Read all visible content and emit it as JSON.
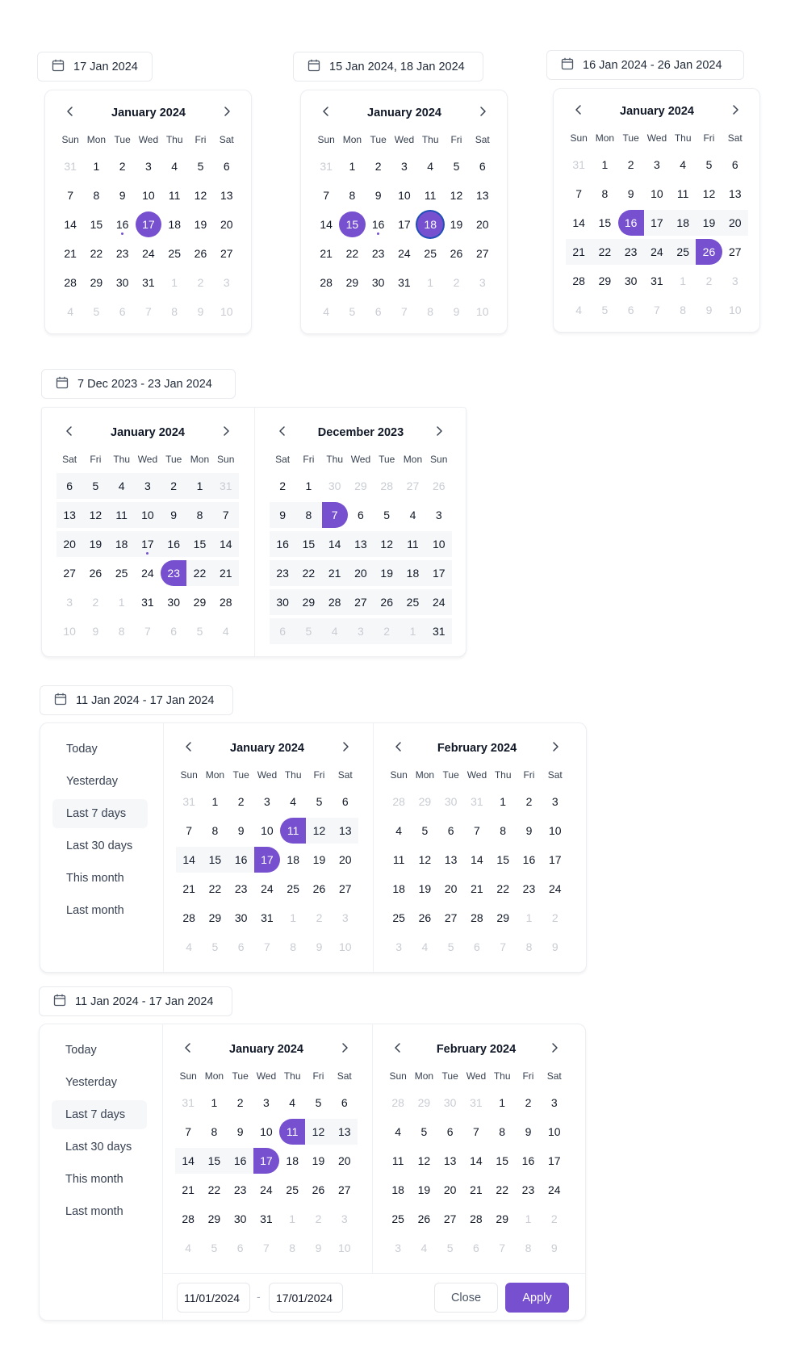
{
  "colors": {
    "accent": "#7650cf",
    "range_bg": "#f6f7f9",
    "focus_ring": "#1f4fb8",
    "outside_text": "#c9ccd3"
  },
  "icons": {
    "trigger": "calendar-icon",
    "prev": "chevron-left-icon",
    "next": "chevron-right-icon"
  },
  "weekdays_ltr": [
    "Sun",
    "Mon",
    "Tue",
    "Wed",
    "Thu",
    "Fri",
    "Sat"
  ],
  "weekdays_rtl": [
    "Sat",
    "Fri",
    "Thu",
    "Wed",
    "Tue",
    "Mon",
    "Sun"
  ],
  "pickers": [
    {
      "id": "single",
      "trigger_label": "17 Jan 2024",
      "calendars": [
        {
          "title": "January 2024",
          "dir": "ltr",
          "year": 2024,
          "month": 1,
          "selected": [
            17
          ],
          "today": 16,
          "range": null,
          "focus": null
        }
      ]
    },
    {
      "id": "multiple",
      "trigger_label": "15 Jan 2024, 18 Jan 2024",
      "calendars": [
        {
          "title": "January 2024",
          "dir": "ltr",
          "year": 2024,
          "month": 1,
          "selected": [
            15,
            18
          ],
          "today": 16,
          "range": null,
          "focus": 18
        }
      ]
    },
    {
      "id": "range",
      "trigger_label": "16 Jan 2024 - 26 Jan 2024",
      "calendars": [
        {
          "title": "January 2024",
          "dir": "ltr",
          "year": 2024,
          "month": 1,
          "selected": [],
          "today": null,
          "range": {
            "from": "2024-01-16",
            "to": "2024-01-26"
          },
          "focus": null
        }
      ]
    },
    {
      "id": "range-rtl",
      "trigger_label": "7 Dec 2023 - 23 Jan 2024",
      "calendars": [
        {
          "title": "January 2024",
          "dir": "rtl",
          "year": 2024,
          "month": 1,
          "selected": [],
          "today": 17,
          "range": {
            "from": "2023-12-07",
            "to": "2024-01-23"
          },
          "focus": null
        },
        {
          "title": "December 2023",
          "dir": "rtl",
          "year": 2023,
          "month": 12,
          "selected": [],
          "today": null,
          "range": {
            "from": "2023-12-07",
            "to": "2024-01-23"
          },
          "focus": null
        }
      ]
    },
    {
      "id": "range-presets",
      "trigger_label": "11 Jan 2024 - 17 Jan 2024",
      "presets": [
        "Today",
        "Yesterday",
        "Last 7 days",
        "Last 30 days",
        "This month",
        "Last month"
      ],
      "active_preset": 2,
      "calendars": [
        {
          "title": "January 2024",
          "dir": "ltr",
          "year": 2024,
          "month": 1,
          "selected": [],
          "today": null,
          "range": {
            "from": "2024-01-11",
            "to": "2024-01-17"
          },
          "focus": null
        },
        {
          "title": "February 2024",
          "dir": "ltr",
          "year": 2024,
          "month": 2,
          "selected": [],
          "today": null,
          "range": {
            "from": "2024-01-11",
            "to": "2024-01-17"
          },
          "focus": null
        }
      ]
    },
    {
      "id": "range-presets-footer",
      "trigger_label": "11 Jan 2024 - 17 Jan 2024",
      "presets": [
        "Today",
        "Yesterday",
        "Last 7 days",
        "Last 30 days",
        "This month",
        "Last month"
      ],
      "active_preset": 2,
      "calendars": [
        {
          "title": "January 2024",
          "dir": "ltr",
          "year": 2024,
          "month": 1,
          "selected": [],
          "today": null,
          "range": {
            "from": "2024-01-11",
            "to": "2024-01-17"
          },
          "focus": null
        },
        {
          "title": "February 2024",
          "dir": "ltr",
          "year": 2024,
          "month": 2,
          "selected": [],
          "today": null,
          "range": {
            "from": "2024-01-11",
            "to": "2024-01-17"
          },
          "focus": null
        }
      ],
      "footer": {
        "start_value": "11/01/2024",
        "end_value": "17/01/2024",
        "separator": "-",
        "close_label": "Close",
        "apply_label": "Apply"
      }
    }
  ]
}
